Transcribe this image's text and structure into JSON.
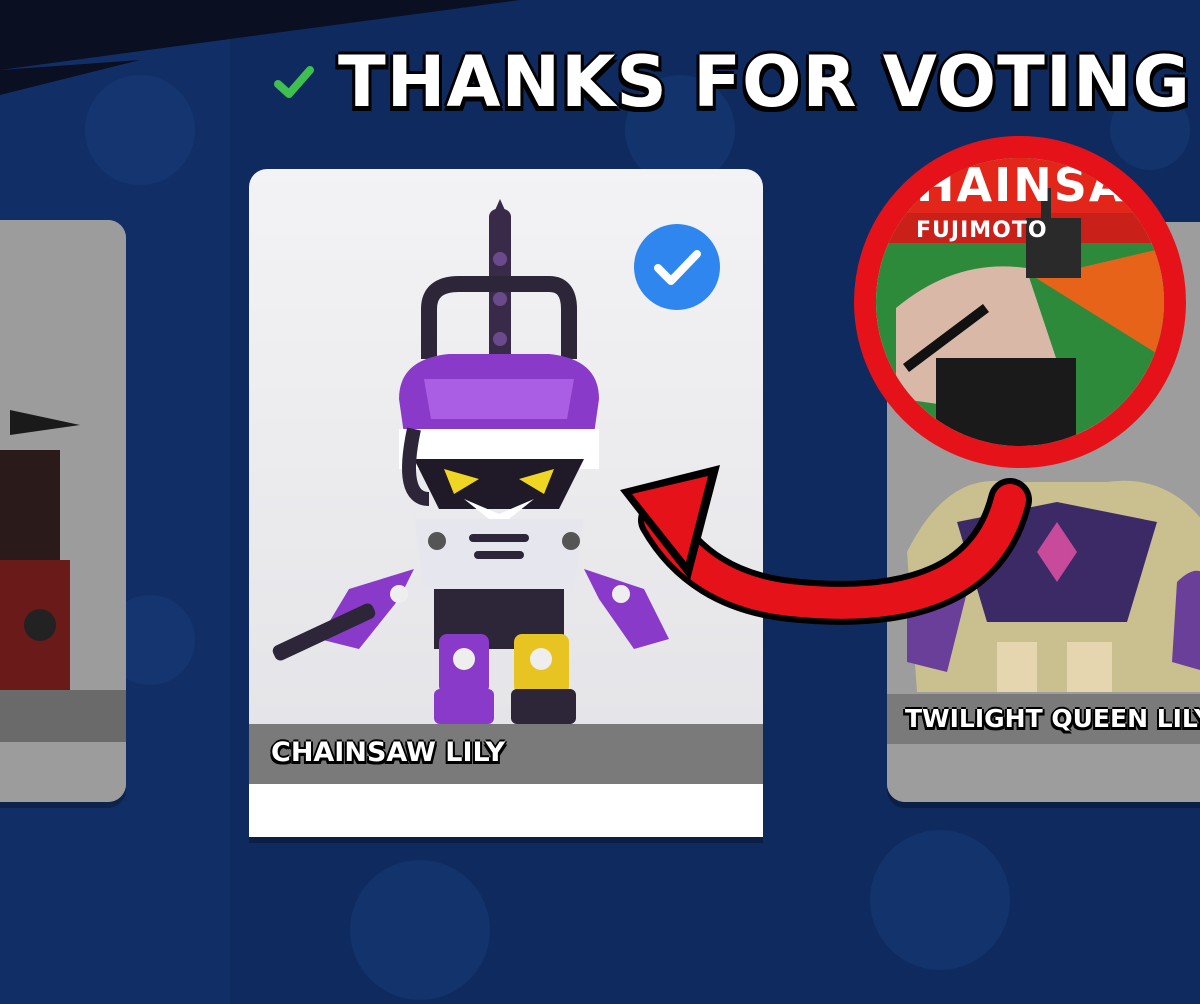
{
  "header": {
    "title": "THANKS FOR VOTING",
    "check_icon": "check-mark-icon",
    "check_color": "#3fbf4f"
  },
  "background": {
    "color": "#0f2a5e",
    "pattern_icon": "skull-logo-icon"
  },
  "cards": {
    "left": {
      "name": "",
      "selected": false
    },
    "center": {
      "name": "CHAINSAW LILY",
      "selected": true,
      "selected_icon": "blue-checkmark-icon"
    },
    "right": {
      "name": "TWILIGHT QUEEN LILY",
      "selected": false
    }
  },
  "annotation": {
    "badge_caption": "FUJIMOTO",
    "badge_title_fragment": "HAINSA",
    "arrow_color": "#e6121a",
    "arrow_icon": "curved-arrow-icon"
  },
  "colors": {
    "accent_red": "#e6121a",
    "vote_blue": "#2f86ee",
    "text_white": "#ffffff"
  }
}
